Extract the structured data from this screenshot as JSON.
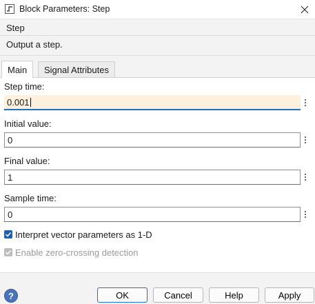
{
  "window": {
    "title": "Block Parameters: Step",
    "icon": "simulink-block-icon"
  },
  "block": {
    "name": "Step",
    "description": "Output a step."
  },
  "tabs": [
    {
      "label": "Main",
      "active": true
    },
    {
      "label": "Signal Attributes",
      "active": false
    }
  ],
  "fields": {
    "step_time": {
      "label": "Step time:",
      "value": "0.001"
    },
    "initial_value": {
      "label": "Initial value:",
      "value": "0"
    },
    "final_value": {
      "label": "Final value:",
      "value": "1"
    },
    "sample_time": {
      "label": "Sample time:",
      "value": "0"
    }
  },
  "checkboxes": {
    "interpret_vector": {
      "label": "Interpret vector parameters as 1-D",
      "checked": true,
      "enabled": true
    },
    "zero_crossing": {
      "label": "Enable zero-crossing detection",
      "checked": true,
      "enabled": false
    }
  },
  "buttons": {
    "ok": "OK",
    "cancel": "Cancel",
    "help": "Help",
    "apply": "Apply",
    "help_icon": "?"
  },
  "colors": {
    "accent": "#1e6fbf",
    "active_field": "#fdf0dc"
  }
}
